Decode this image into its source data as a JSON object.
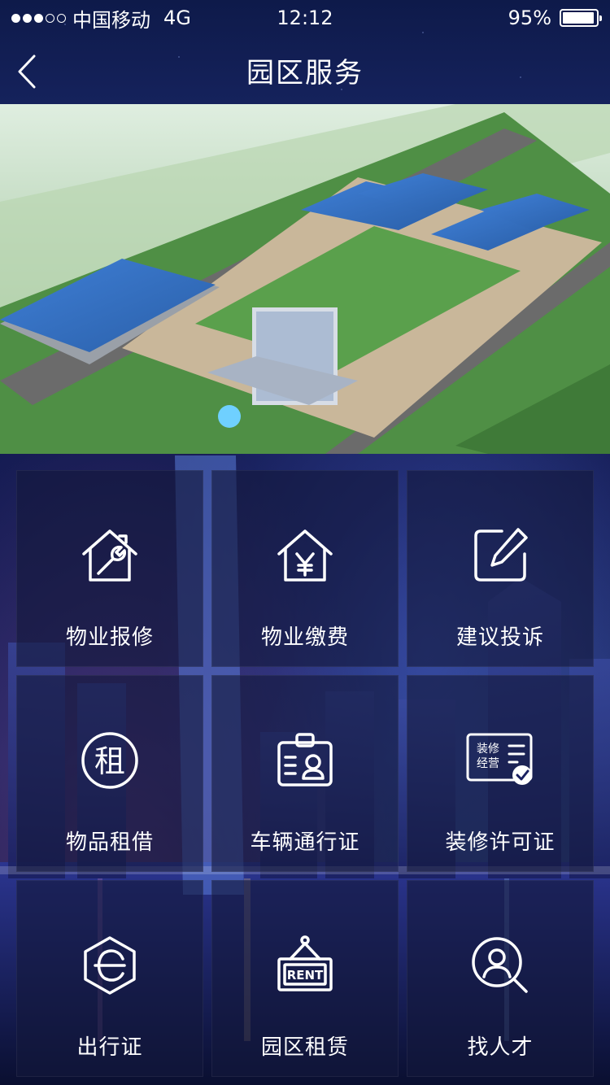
{
  "status_bar": {
    "carrier": "中国移动",
    "network": "4G",
    "time": "12:12",
    "battery": "95%",
    "battery_level": 0.95
  },
  "nav": {
    "title": "园区服务",
    "back_icon": "chevron-left-icon"
  },
  "banner": {
    "description_icon": "industrial-park-aerial-image"
  },
  "services": [
    {
      "label": "物业报修",
      "icon": "house-wrench-icon"
    },
    {
      "label": "物业缴费",
      "icon": "house-yen-icon"
    },
    {
      "label": "建议投诉",
      "icon": "edit-square-icon"
    },
    {
      "label": "物品租借",
      "icon": "rent-circle-icon",
      "icon_text": "租"
    },
    {
      "label": "车辆通行证",
      "icon": "id-badge-icon"
    },
    {
      "label": "装修许可证",
      "icon": "decoration-permit-icon",
      "icon_text": "装修\n经营"
    },
    {
      "label": "出行证",
      "icon": "travel-pass-icon"
    },
    {
      "label": "园区租赁",
      "icon": "rent-sign-icon",
      "icon_text": "RENT"
    },
    {
      "label": "找人才",
      "icon": "search-person-icon"
    }
  ],
  "colors": {
    "header": "#15225c",
    "tile": "#14183c",
    "text": "#ffffff"
  }
}
